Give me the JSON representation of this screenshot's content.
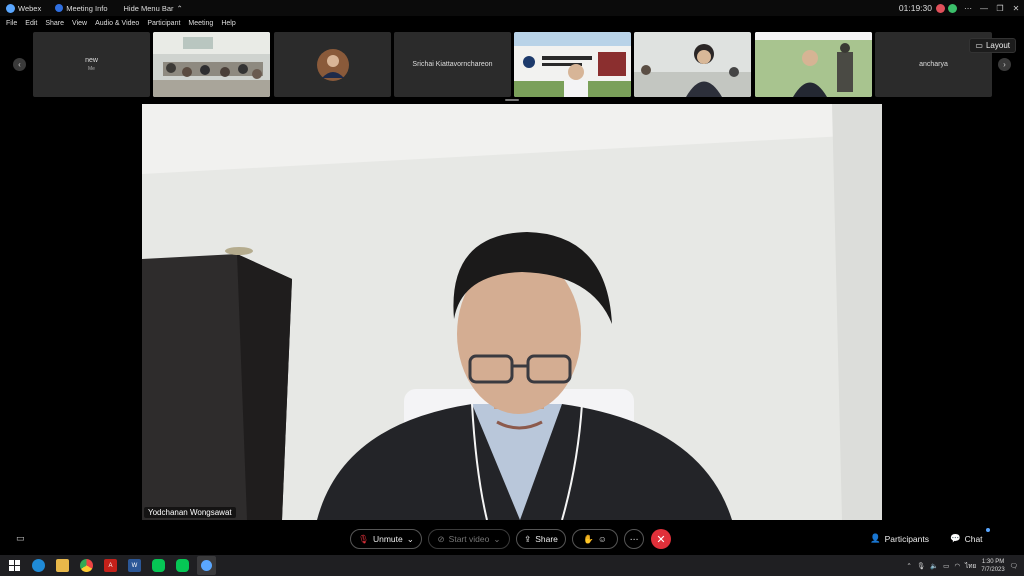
{
  "titlebar": {
    "app_name": "Webex",
    "meeting_info": "Meeting Info",
    "hide_menu_bar": "Hide Menu Bar",
    "time": "01:19:30",
    "window_controls": [
      "⋯",
      "—",
      "❐",
      "✕"
    ]
  },
  "menu": [
    "File",
    "Edit",
    "Share",
    "View",
    "Audio & Video",
    "Participant",
    "Meeting",
    "Help"
  ],
  "filmstrip": {
    "tiles": [
      {
        "name": "new",
        "sub": "Me",
        "kind": "placeholder"
      },
      {
        "name": "",
        "sub": "",
        "kind": "conference-room"
      },
      {
        "name": "",
        "sub": "",
        "kind": "avatar"
      },
      {
        "name": "Srichai Kiattavornchareon",
        "sub": "",
        "kind": "placeholder"
      },
      {
        "name": "",
        "sub": "",
        "kind": "mahidol"
      },
      {
        "name": "",
        "sub": "",
        "kind": "woman"
      },
      {
        "name": "",
        "sub": "",
        "kind": "statue"
      },
      {
        "name": "ancharya",
        "sub": "",
        "kind": "placeholder"
      }
    ],
    "layout_label": "Layout"
  },
  "main_video": {
    "speaker_name": "Yodchanan Wongsawat"
  },
  "controls": {
    "unmute": "Unmute",
    "start_video": "Start video",
    "share": "Share",
    "participants": "Participants",
    "chat": "Chat"
  },
  "taskbar": {
    "time": "1:30 PM",
    "date": "7/7/2023",
    "language": "ไทย"
  },
  "colors": {
    "end_call": "#e0303a",
    "accent": "#5aa7ff"
  }
}
